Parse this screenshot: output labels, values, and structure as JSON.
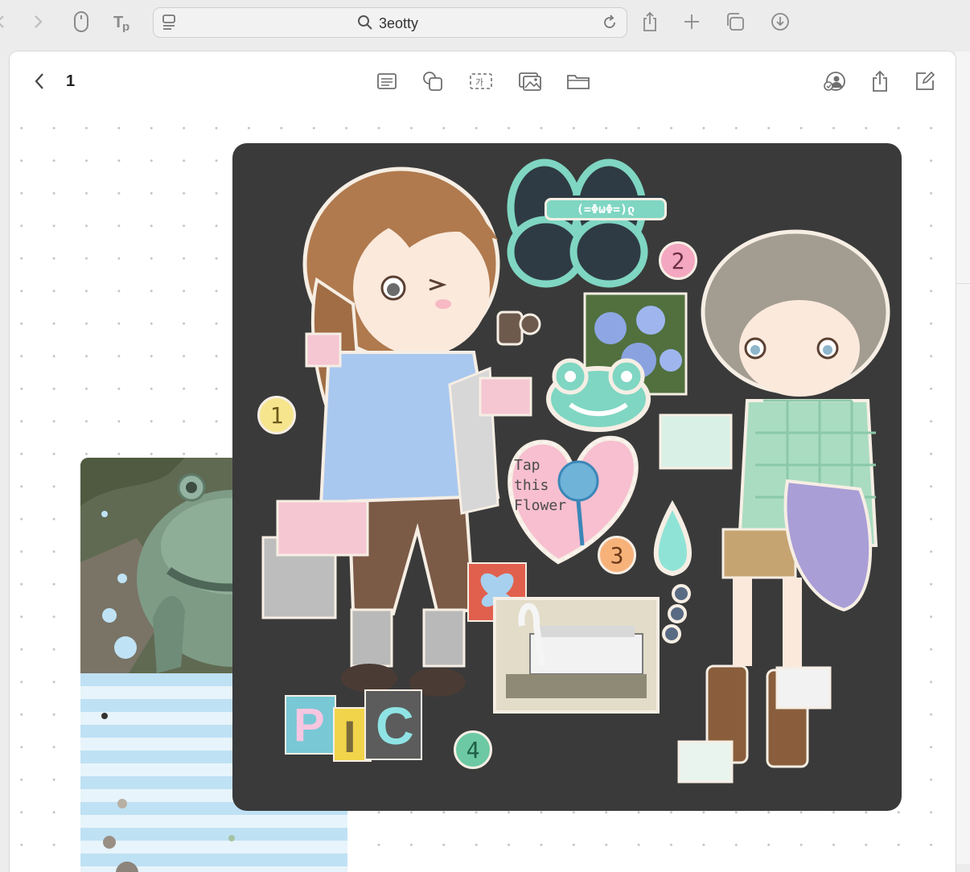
{
  "browser": {
    "address_text": "3eotty"
  },
  "app": {
    "page_number": "1"
  },
  "stickers": {
    "emoticon": "(=ΦωΦ=)ლ",
    "flower_caption": [
      "Tap",
      "this",
      "Flower"
    ],
    "num1": "1",
    "num2": "2",
    "num3": "3",
    "num4": "4",
    "pic_letters": [
      "P",
      "I",
      "C"
    ]
  },
  "colors": {
    "board_bg": "#3a3a3a",
    "num1": "#f6e58d",
    "num2": "#f4a7c0",
    "num3": "#f7b27a",
    "num4": "#6cc9a4",
    "mint": "#7fd6c2",
    "sky": "#a9c8ef"
  }
}
